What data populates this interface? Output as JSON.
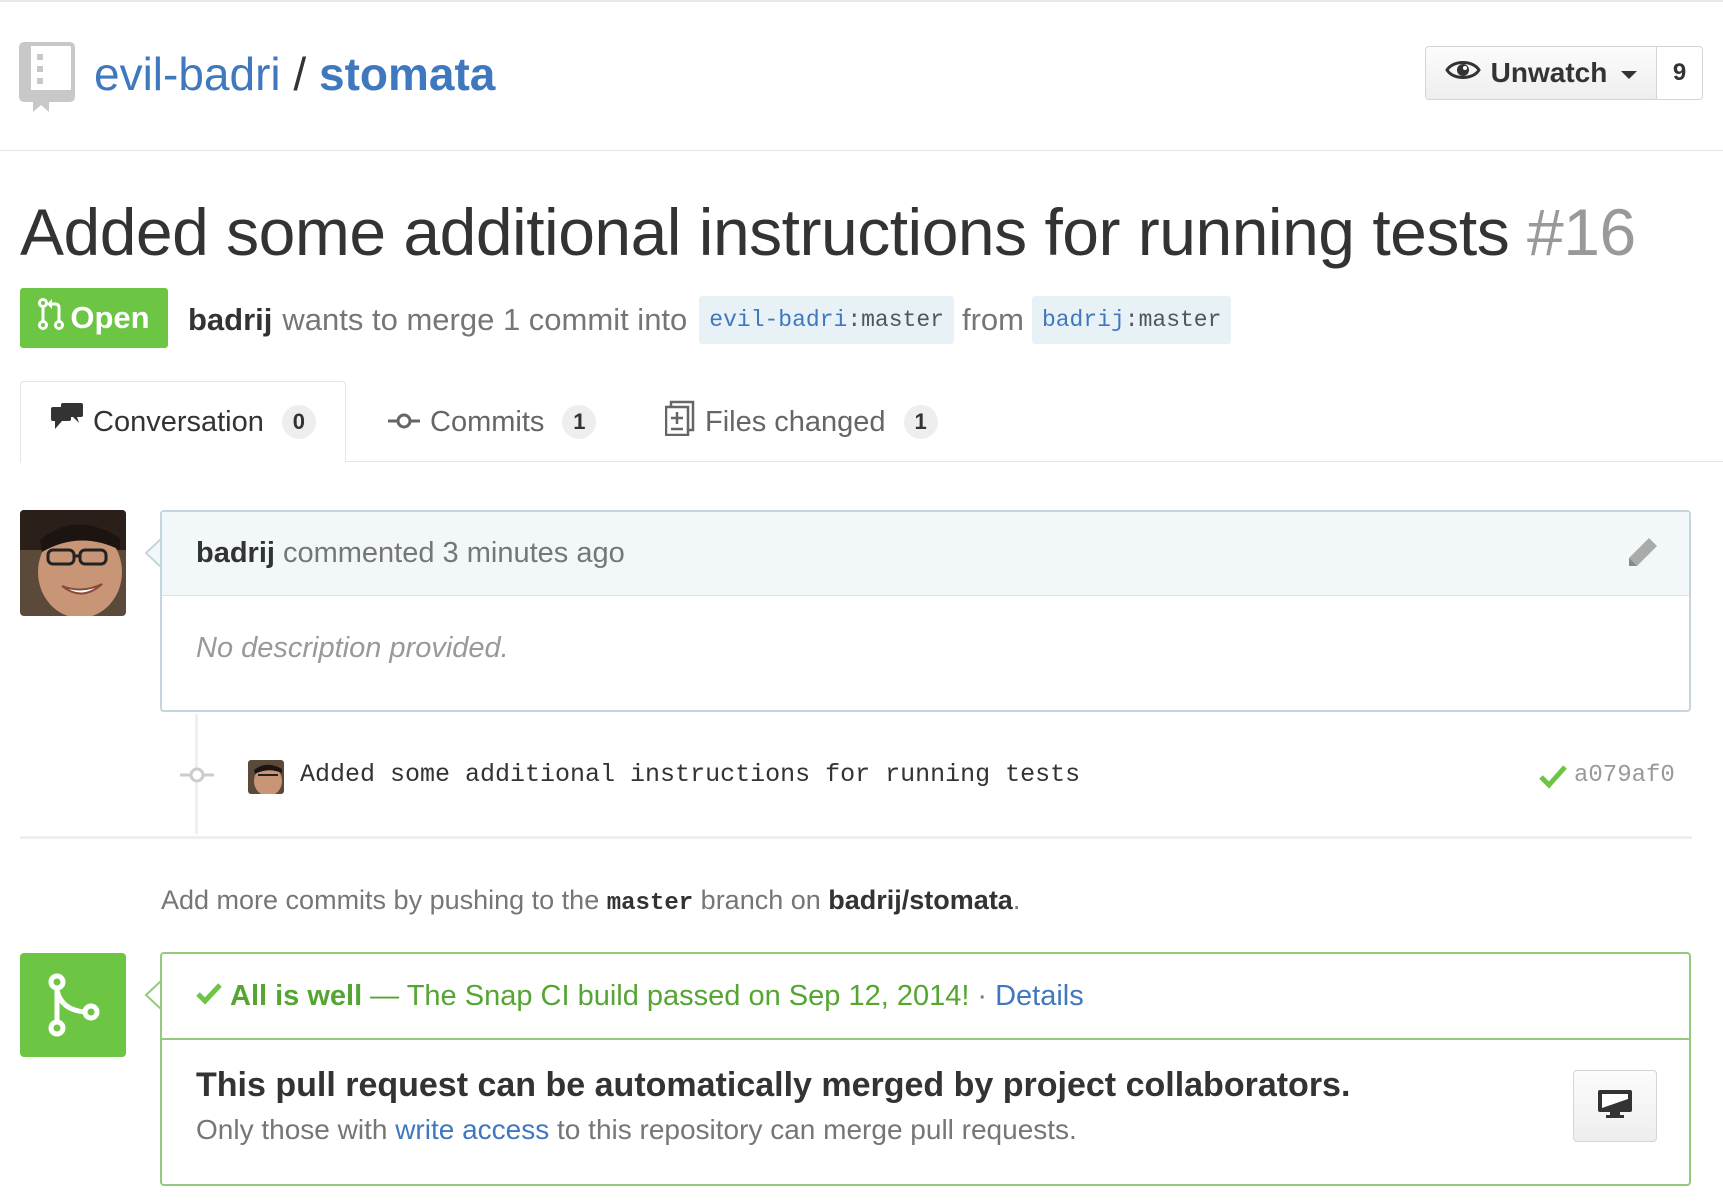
{
  "repo": {
    "owner": "evil-badri",
    "separator": "/",
    "name": "stomata"
  },
  "watch": {
    "label": "Unwatch",
    "count": "9"
  },
  "pull_request": {
    "title": "Added some additional instructions for running tests",
    "number": "#16",
    "state": "Open",
    "author": "badrij",
    "merge_text": "wants to merge 1 commit into",
    "base_user": "evil-badri",
    "base_branch": ":master",
    "from_text": "from",
    "head_user": "badrij",
    "head_branch": ":master"
  },
  "tabs": [
    {
      "label": "Conversation",
      "count": "0",
      "icon": "comment-discussion-icon"
    },
    {
      "label": "Commits",
      "count": "1",
      "icon": "git-commit-icon"
    },
    {
      "label": "Files changed",
      "count": "1",
      "icon": "diff-icon"
    }
  ],
  "comment": {
    "author": "badrij",
    "action": "commented 3 minutes ago",
    "body": "No description provided."
  },
  "commit": {
    "message": "Added some additional instructions for running tests",
    "sha": "a079af0",
    "status": "success"
  },
  "push_hint": {
    "prefix": "Add more commits by pushing to the",
    "branch": "master",
    "middle": "branch on",
    "repo": "badrij/stomata",
    "suffix": "."
  },
  "merge": {
    "status_strong": "All is well",
    "status_text": "— The Snap CI build passed on Sep 12, 2014!",
    "dot": "·",
    "details_label": "Details",
    "title": "This pull request can be automatically merged by project collaborators.",
    "sub_prefix": "Only those with",
    "sub_link": "write access",
    "sub_suffix": "to this repository can merge pull requests."
  },
  "colors": {
    "link": "#4078c0",
    "open_green": "#6cc644",
    "success_green": "#55a532"
  }
}
